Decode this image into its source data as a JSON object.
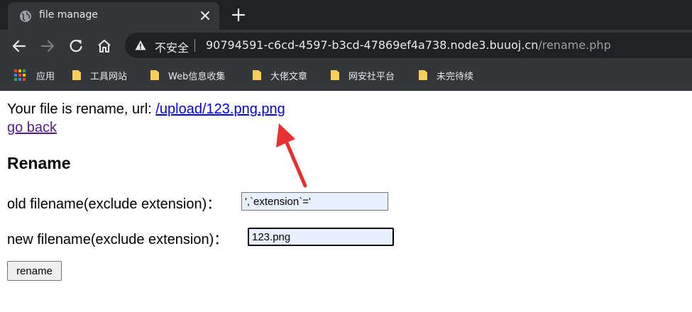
{
  "browser": {
    "tab": {
      "title": "file manage"
    },
    "security_label": "不安全",
    "url": {
      "host": "90794591-c6cd-4597-b3cd-47869ef4a738.node3.buuoj.cn",
      "path": "/rename.php"
    },
    "bookmarks": [
      {
        "label": "应用",
        "icon": "apps-grid-icon"
      },
      {
        "label": "工具网站",
        "icon": "folder-icon"
      },
      {
        "label": "Web信息收集",
        "icon": "folder-icon"
      },
      {
        "label": "大佬文章",
        "icon": "folder-icon"
      },
      {
        "label": "网安社平台",
        "icon": "folder-icon"
      },
      {
        "label": "未完待续",
        "icon": "folder-icon"
      }
    ]
  },
  "page": {
    "result_prefix": "Your file is rename, url: ",
    "result_url": "/upload/123.png.png",
    "go_back": "go back",
    "heading": "Rename",
    "old_label": "old filename(exclude extension)：",
    "old_value": "',`extension`='",
    "new_label": "new filename(exclude extension)：",
    "new_value": "123.png",
    "submit_label": "rename"
  },
  "colors": {
    "chrome_dark": "#202124",
    "chrome_mid": "#35363a",
    "link": "#0000ee",
    "visited_link": "#551a8b",
    "input_autofill": "#e8f0fe",
    "arrow": "#e8312f"
  }
}
